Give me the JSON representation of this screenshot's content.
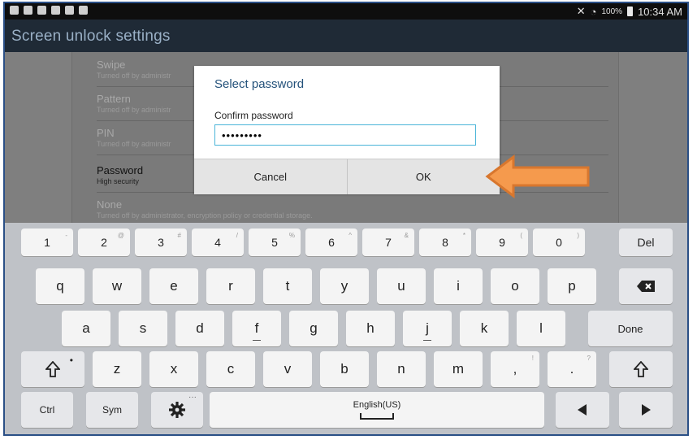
{
  "status_bar": {
    "battery": "100%",
    "time": "10:34 AM"
  },
  "action_bar": {
    "title": "Screen unlock settings"
  },
  "unlock_options": [
    {
      "title": "Swipe",
      "subtitle": "Turned off by administr"
    },
    {
      "title": "Pattern",
      "subtitle": "Turned off by administr"
    },
    {
      "title": "PIN",
      "subtitle": "Turned off by administr"
    },
    {
      "title": "Password",
      "subtitle": "High security"
    },
    {
      "title": "None",
      "subtitle": "Turned off by administrator, encryption policy or credential storage."
    }
  ],
  "dialog": {
    "title": "Select password",
    "field_label": "Confirm password",
    "field_value": "•••••••••",
    "cancel_label": "Cancel",
    "ok_label": "OK"
  },
  "annotation": {
    "arrow_color": "#f59a4d",
    "arrow_outline": "#d8772e"
  },
  "keyboard": {
    "number_row": [
      {
        "label": "1",
        "alt": "-"
      },
      {
        "label": "2",
        "alt": "@"
      },
      {
        "label": "3",
        "alt": "#"
      },
      {
        "label": "4",
        "alt": "/"
      },
      {
        "label": "5",
        "alt": "%"
      },
      {
        "label": "6",
        "alt": "^"
      },
      {
        "label": "7",
        "alt": "&"
      },
      {
        "label": "8",
        "alt": "*"
      },
      {
        "label": "9",
        "alt": "("
      },
      {
        "label": "0",
        "alt": ")"
      }
    ],
    "del_label": "Del",
    "row1": [
      "q",
      "w",
      "e",
      "r",
      "t",
      "y",
      "u",
      "i",
      "o",
      "p"
    ],
    "row2": [
      "a",
      "s",
      "d",
      "f",
      "g",
      "h",
      "j",
      "k",
      "l"
    ],
    "done_label": "Done",
    "row3": [
      "z",
      "x",
      "c",
      "v",
      "b",
      "n",
      "m"
    ],
    "comma_key": {
      "label": ",",
      "alt": "!"
    },
    "period_key": {
      "label": ".",
      "alt": "?"
    },
    "ctrl_label": "Ctrl",
    "sym_label": "Sym",
    "space_label": "English(US)"
  }
}
